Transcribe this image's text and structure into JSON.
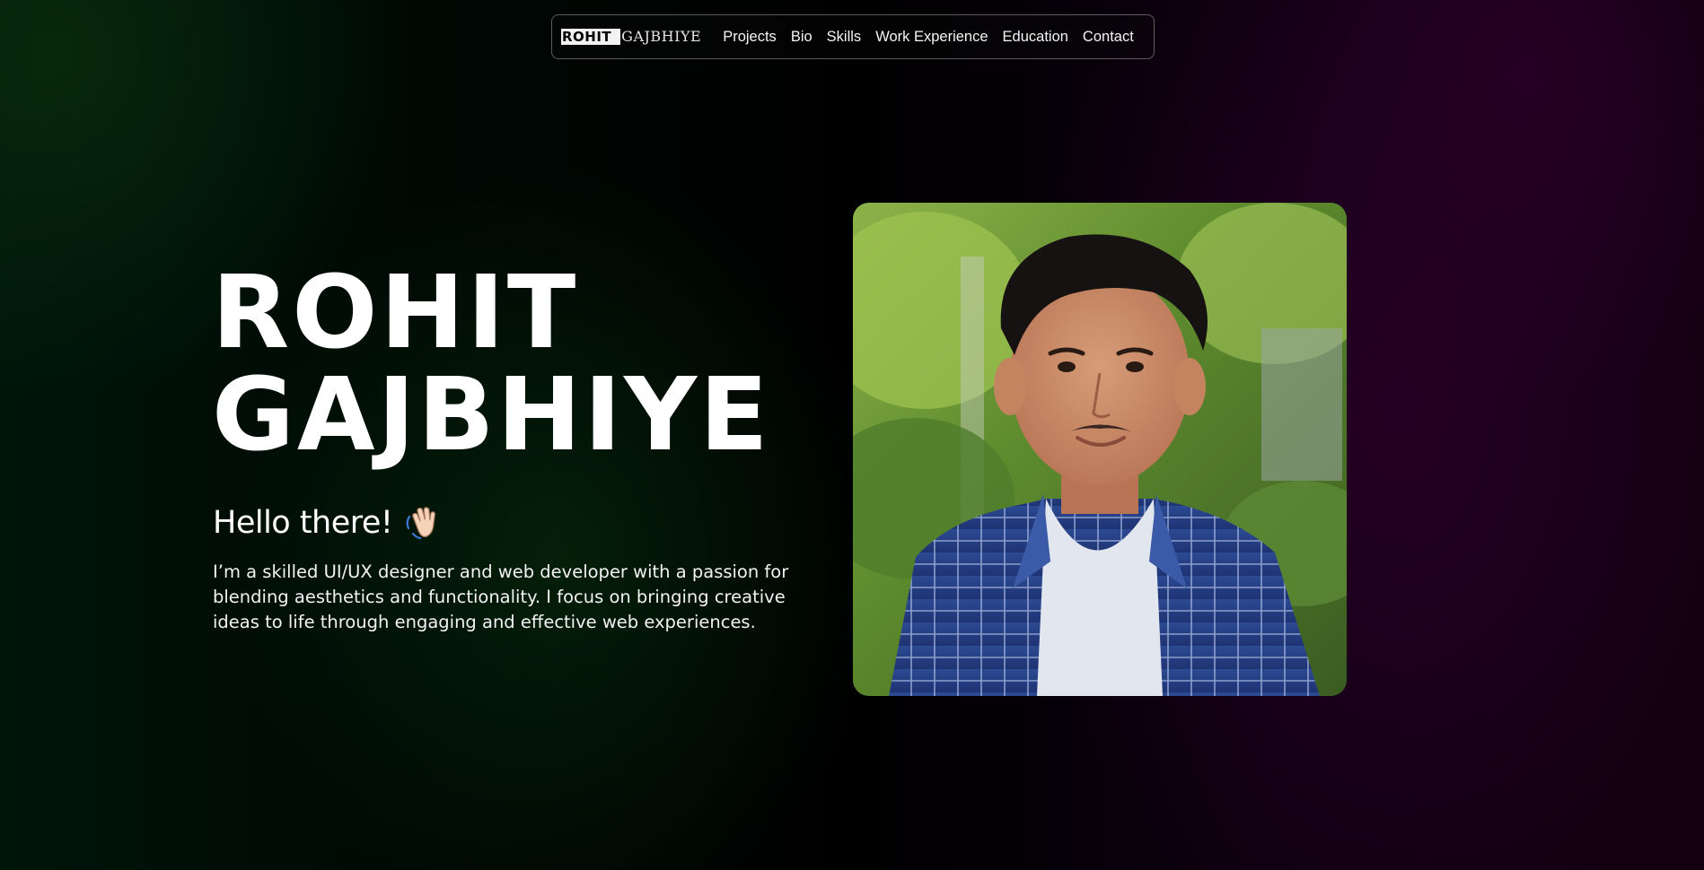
{
  "nav": {
    "logo": {
      "first": "ROHIT",
      "last": "GAJBHIYE"
    },
    "items": [
      "Projects",
      "Bio",
      "Skills",
      "Work Experience",
      "Education",
      "Contact"
    ]
  },
  "hero": {
    "name_line1": "ROHIT",
    "name_line2": "GAJBHIYE",
    "greeting": "Hello there!",
    "greeting_icon": "waving-hand-icon",
    "bio": "I’m a skilled UI/UX designer and web developer with a passion for blending aesthetics and functionality. I focus on bringing creative ideas to life through engaging and effective web experiences.",
    "portrait_icon": "profile-photo"
  },
  "colors": {
    "text": "#ffffff",
    "background_left": "#00150a",
    "background_right": "#120010"
  }
}
